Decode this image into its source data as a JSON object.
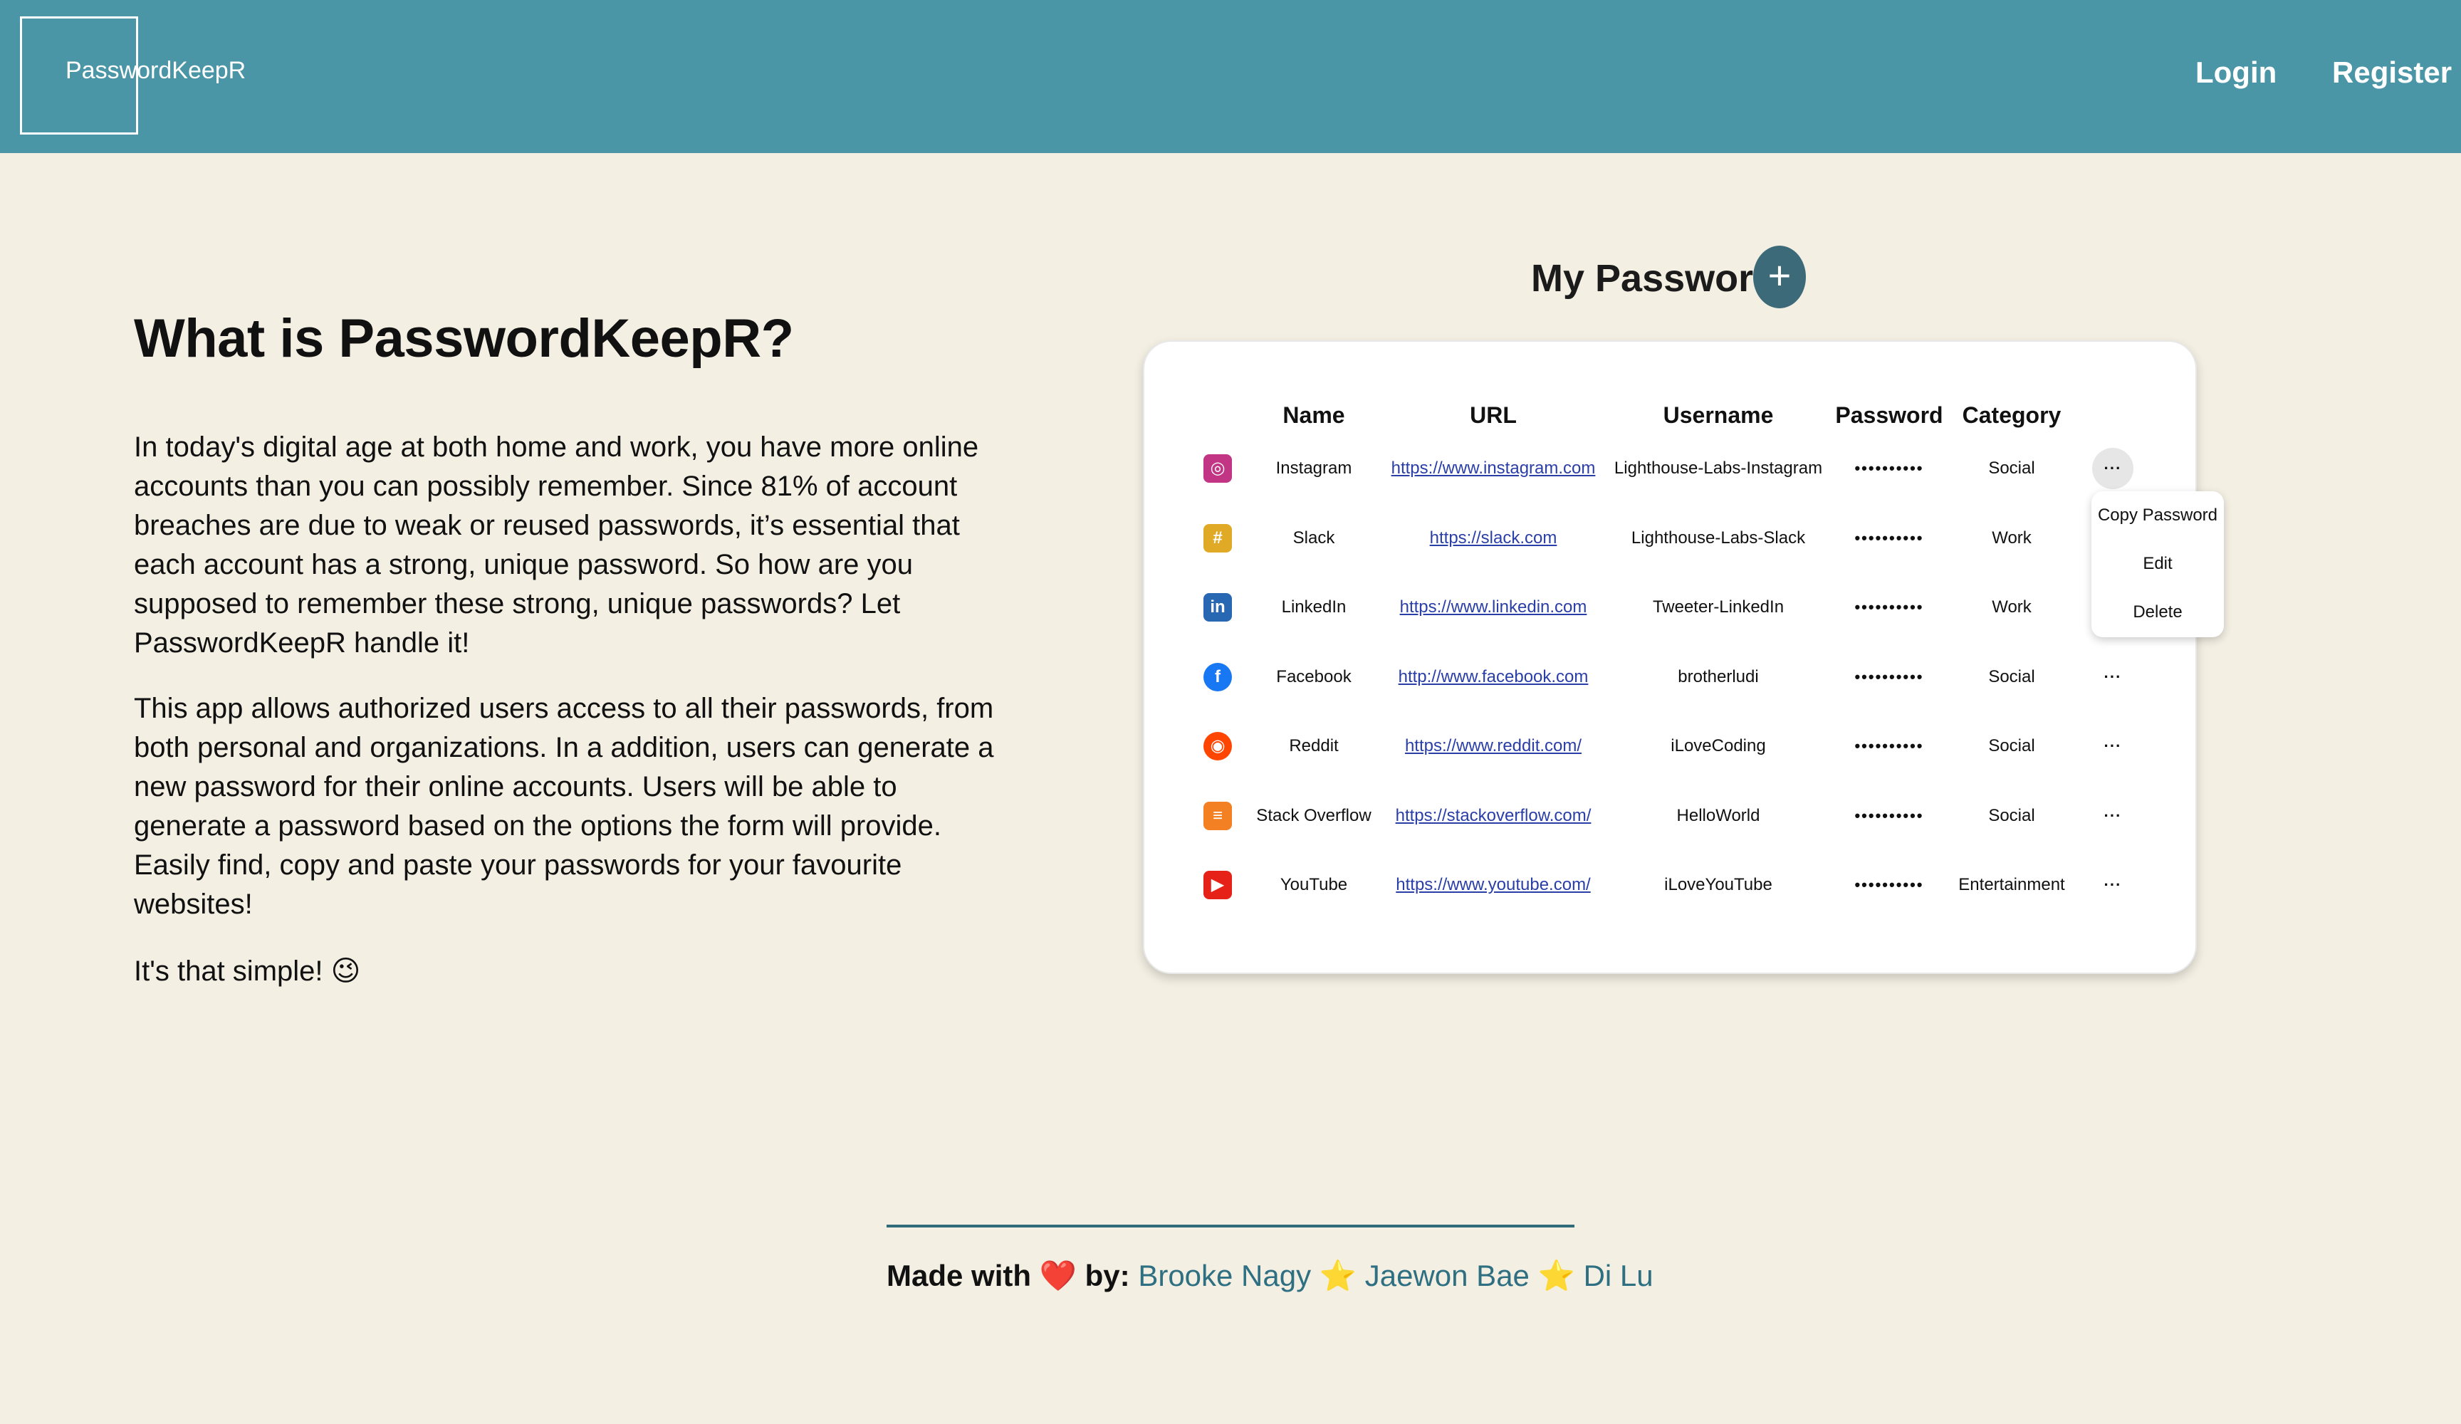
{
  "header": {
    "logo_text": "PasswordKeepR",
    "nav": {
      "login": "Login",
      "register": "Register"
    }
  },
  "hero": {
    "title": "What is PasswordKeepR?",
    "paragraphs": [
      "In today's digital age at both home and work, you have more online accounts than you can possibly remember. Since 81% of account breaches are due to weak or reused passwords, it’s essential that each account has a strong, unique password. So how are you supposed to remember these strong, unique passwords? Let PasswordKeepR handle it!",
      "This app allows authorized users access to all their passwords, from both personal and organizations. In a addition, users can generate a new password for their online accounts. Users will be able to generate a password based on the options the form will provide. Easily find, copy and paste your passwords for your favourite websites!",
      "It's that simple! 😉"
    ]
  },
  "preview": {
    "title": "My Passwords",
    "add_icon": "plus-icon",
    "columns": [
      "Name",
      "URL",
      "Username",
      "Password",
      "Category"
    ],
    "rows": [
      {
        "icon": "instagram-icon",
        "name": "Instagram",
        "url": "https://www.instagram.com",
        "username": "Lighthouse-Labs-Instagram",
        "password": "••••••••••",
        "category": "Social"
      },
      {
        "icon": "slack-icon",
        "name": "Slack",
        "url": "https://slack.com",
        "username": "Lighthouse-Labs-Slack",
        "password": "••••••••••",
        "category": "Work"
      },
      {
        "icon": "linkedin-icon",
        "name": "LinkedIn",
        "url": "https://www.linkedin.com",
        "username": "Tweeter-LinkedIn",
        "password": "••••••••••",
        "category": "Work"
      },
      {
        "icon": "facebook-icon",
        "name": "Facebook",
        "url": "http://www.facebook.com",
        "username": "brotherludi",
        "password": "••••••••••",
        "category": "Social"
      },
      {
        "icon": "reddit-icon",
        "name": "Reddit",
        "url": "https://www.reddit.com/",
        "username": "iLoveCoding",
        "password": "••••••••••",
        "category": "Social"
      },
      {
        "icon": "stackoverflow-icon",
        "name": "Stack Overflow",
        "url": "https://stackoverflow.com/",
        "username": "HelloWorld",
        "password": "••••••••••",
        "category": "Social"
      },
      {
        "icon": "youtube-icon",
        "name": "YouTube",
        "url": "https://www.youtube.com/",
        "username": "iLoveYouTube",
        "password": "••••••••••",
        "category": "Entertainment"
      }
    ],
    "menu": [
      "Copy Password",
      "Edit",
      "Delete"
    ],
    "kebab": "···"
  },
  "footer": {
    "prefix": "Made with ❤️ by:",
    "authors": [
      "Brooke Nagy",
      "Jaewon Bae",
      "Di Lu"
    ],
    "separator": "⭐"
  },
  "colors": {
    "header": "#4a96a6",
    "background": "#f3efe3",
    "accent": "#3c6a78",
    "author_link": "#2e6f82"
  }
}
